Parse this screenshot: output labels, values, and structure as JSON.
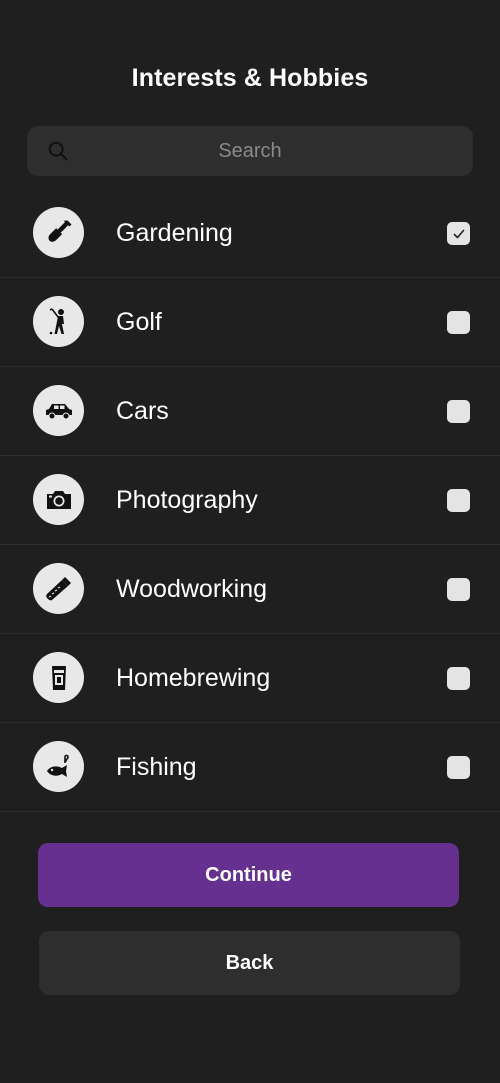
{
  "header": {
    "title": "Interests & Hobbies"
  },
  "search": {
    "placeholder": "Search",
    "value": ""
  },
  "interests": [
    {
      "label": "Gardening",
      "icon": "shovel-icon",
      "checked": true
    },
    {
      "label": "Golf",
      "icon": "golfer-icon",
      "checked": false
    },
    {
      "label": "Cars",
      "icon": "car-icon",
      "checked": false
    },
    {
      "label": "Photography",
      "icon": "camera-icon",
      "checked": false
    },
    {
      "label": "Woodworking",
      "icon": "handsaw-icon",
      "checked": false
    },
    {
      "label": "Homebrewing",
      "icon": "beer-glass-icon",
      "checked": false
    },
    {
      "label": "Fishing",
      "icon": "fish-hook-icon",
      "checked": false
    }
  ],
  "actions": {
    "continue_label": "Continue",
    "back_label": "Back"
  },
  "colors": {
    "background": "#1f1f1f",
    "accent": "#65308f",
    "secondary_button": "#2e2e2e",
    "icon_circle": "#e8e8e8"
  }
}
